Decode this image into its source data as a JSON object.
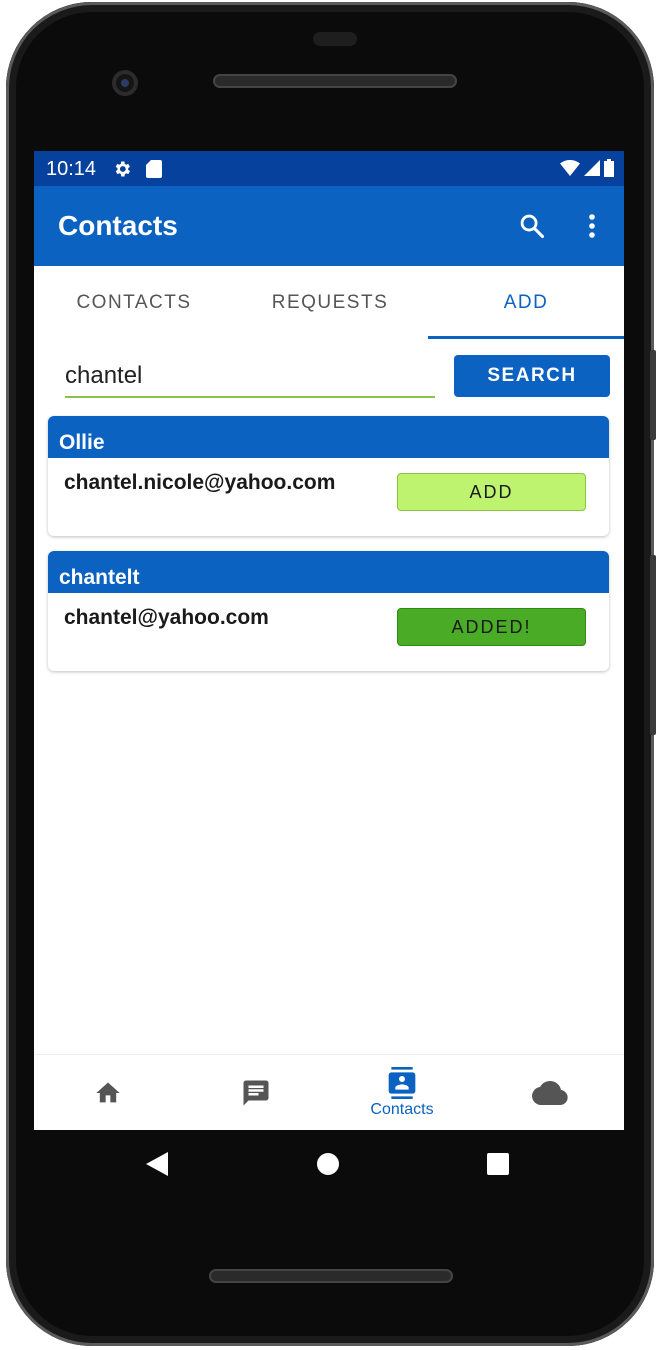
{
  "status": {
    "time": "10:14",
    "icons": [
      "gear-icon",
      "sd-card-icon",
      "wifi-icon",
      "signal-icon",
      "battery-icon"
    ]
  },
  "appbar": {
    "title": "Contacts",
    "icons": [
      "search-icon",
      "more-vert-icon"
    ]
  },
  "tabs": [
    {
      "label": "CONTACTS",
      "active": false
    },
    {
      "label": "REQUESTS",
      "active": false
    },
    {
      "label": "ADD",
      "active": true
    }
  ],
  "search": {
    "value": "chantel",
    "button_label": "SEARCH"
  },
  "results": [
    {
      "name": "Ollie",
      "email": "chantel.nicole@yahoo.com",
      "button_label": "ADD",
      "state": "add"
    },
    {
      "name": "chantelt",
      "email": "chantel@yahoo.com",
      "button_label": "ADDED!",
      "state": "added"
    }
  ],
  "bottom_nav": [
    {
      "icon": "home-icon",
      "label": ""
    },
    {
      "icon": "chat-icon",
      "label": ""
    },
    {
      "icon": "contacts-icon",
      "label": "Contacts",
      "active": true
    },
    {
      "icon": "cloud-icon",
      "label": ""
    }
  ],
  "colors": {
    "primary": "#0b62c1",
    "status_bar": "#07419e",
    "add_button": "#bef36f",
    "added_button": "#49ab26",
    "input_underline": "#8bc34a"
  }
}
